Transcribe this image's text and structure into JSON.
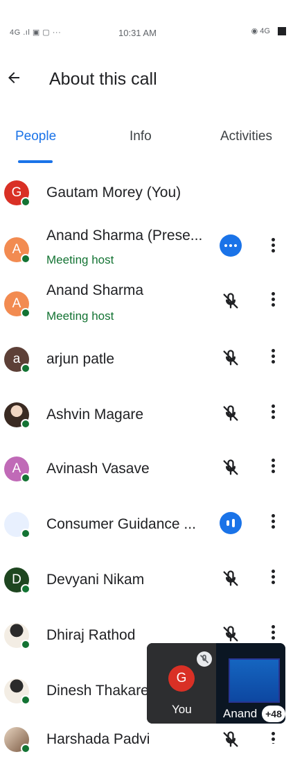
{
  "status_bar": {
    "left": "4G .ıl  ▣ ▢ ···",
    "time": "10:31 AM",
    "right": "◉ 4G"
  },
  "header": {
    "title": "About this call"
  },
  "tabs": [
    {
      "label": "People"
    },
    {
      "label": "Info"
    },
    {
      "label": "Activities"
    }
  ],
  "people": [
    {
      "name": "Gautam Morey (You)",
      "initial": "G",
      "color": "#d93025"
    },
    {
      "name": "Anand Sharma (Prese...",
      "subtitle": "Meeting host",
      "initial": "A",
      "color": "#f28b51",
      "state": "speaking"
    },
    {
      "name": "Anand Sharma",
      "subtitle": "Meeting host",
      "initial": "A",
      "color": "#f28b51",
      "state": "muted"
    },
    {
      "name": "arjun patle",
      "initial": "a",
      "color": "#5d4037",
      "state": "muted"
    },
    {
      "name": "Ashvin Magare",
      "state": "muted"
    },
    {
      "name": "Avinash Vasave",
      "initial": "A",
      "color": "#c06ab7",
      "state": "muted"
    },
    {
      "name": "Consumer Guidance ...",
      "state": "speaking"
    },
    {
      "name": "Devyani Nikam",
      "initial": "D",
      "color": "#1e4620",
      "state": "muted"
    },
    {
      "name": "Dhiraj Rathod",
      "state": "muted"
    },
    {
      "name": "Dinesh Thakare",
      "state": "muted"
    },
    {
      "name": "Harshada Padvi",
      "state": "muted"
    }
  ],
  "pip": {
    "self_initial": "G",
    "self_label": "You",
    "other_label": "Anand",
    "count": "+48"
  },
  "colors": {
    "accent": "#1a73e8",
    "online": "#137333"
  }
}
